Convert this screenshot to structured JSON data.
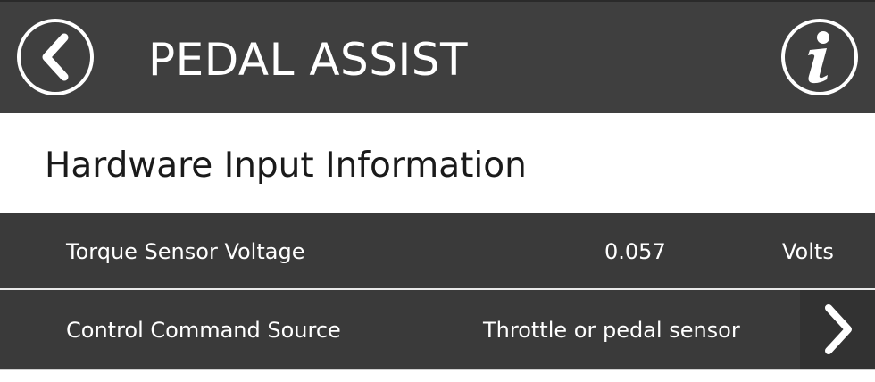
{
  "header": {
    "title": "PEDAL ASSIST",
    "back_icon": "chevron-left-icon",
    "info_icon": "info-icon"
  },
  "section": {
    "title": "Hardware Input Information"
  },
  "rows": [
    {
      "label": "Torque Sensor Voltage",
      "value": "0.057",
      "unit": "Volts"
    },
    {
      "label": "Control Command Source",
      "value": "Throttle or pedal sensor",
      "action_icon": "chevron-right-icon"
    }
  ],
  "colors": {
    "header_bg": "#3f3f3f",
    "row_bg": "#3a3a3a",
    "text_light": "#ffffff",
    "text_dark": "#1a1a1a"
  }
}
